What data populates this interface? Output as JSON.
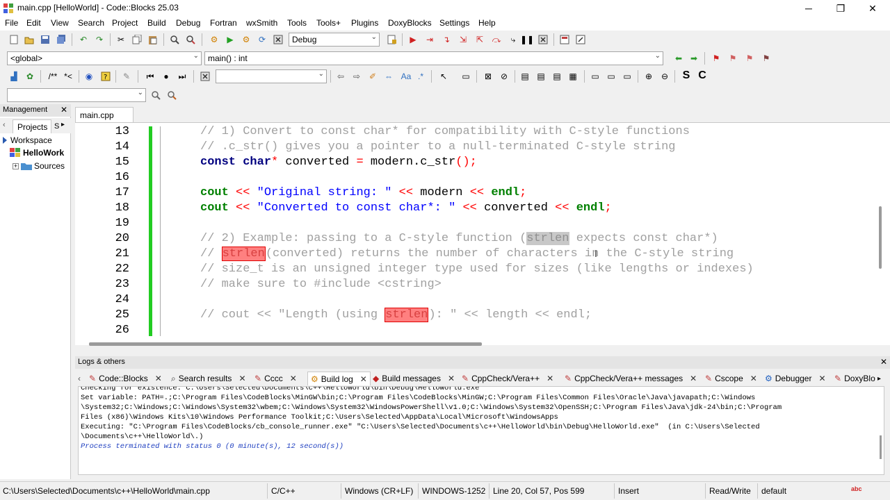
{
  "window": {
    "title": "main.cpp [HelloWorld] - Code::Blocks 25.03",
    "minimize": "─",
    "maximize": "❐",
    "close": "✕"
  },
  "menu": [
    "File",
    "Edit",
    "View",
    "Search",
    "Project",
    "Build",
    "Debug",
    "Fortran",
    "wxSmith",
    "Tools",
    "Tools+",
    "Plugins",
    "DoxyBlocks",
    "Settings",
    "Help"
  ],
  "toolbar": {
    "build_target": "Debug",
    "scope": "<global>",
    "function": "main() : int",
    "search_value": "",
    "find_value": ""
  },
  "management": {
    "title": "Management",
    "tab_projects": "Projects",
    "tab_symbols": "S",
    "workspace": "Workspace",
    "project": "HelloWork",
    "sources": "Sources"
  },
  "editor": {
    "tab_label": "main.cpp"
  },
  "code_lines": [
    {
      "n": "13",
      "text": "// 1) Convert to const char* for compatibility with C-style functions"
    },
    {
      "n": "14",
      "text": "// .c_str() gives you a pointer to a null-terminated C-style string"
    },
    {
      "n": "15",
      "p1": "const char",
      "p2": "*",
      "p3": " converted ",
      "p4": "=",
      "p5": " modern.c_str",
      "p6": "();"
    },
    {
      "n": "16"
    },
    {
      "n": "17",
      "p1": "cout",
      "p2": " << ",
      "p3": "\"Original string: \"",
      "p4": " << ",
      "p5": "modern",
      "p6": " << ",
      "p7": "endl",
      "p8": ";"
    },
    {
      "n": "18",
      "p1": "cout",
      "p2": " << ",
      "p3": "\"Converted to const char*: \"",
      "p4": " << ",
      "p5": "converted",
      "p6": " << ",
      "p7": "endl",
      "p8": ";"
    },
    {
      "n": "19"
    },
    {
      "n": "20",
      "p1": "// 2) Example: passing to a C-style function (",
      "p2": "strlen",
      "p3": " expects const char*)"
    },
    {
      "n": "21",
      "p1": "// ",
      "p2": "strlen",
      "p3": "(converted) returns the number of characters in the C-style string"
    },
    {
      "n": "22",
      "text": "// size_t is an unsigned integer type used for sizes (like lengths or indexes)"
    },
    {
      "n": "23",
      "text": "// make sure to #include <cstring>"
    },
    {
      "n": "24"
    },
    {
      "n": "25",
      "p1": "// cout << \"Length (using ",
      "p2": "strlen",
      "p3": "): \" << length << endl;"
    },
    {
      "n": "26"
    }
  ],
  "logs": {
    "title": "Logs & others",
    "tabs": [
      "Code::Blocks",
      "Search results",
      "Cccc",
      "Build log",
      "Build messages",
      "CppCheck/Vera++",
      "CppCheck/Vera++ messages",
      "Cscope",
      "Debugger",
      "DoxyBlo"
    ],
    "lines": [
      "Checking for existence: C:\\Users\\Selected\\Documents\\c++\\HelloWorld\\bin\\Debug\\HelloWorld.exe",
      "Set variable: PATH=.;C:\\Program Files\\CodeBlocks\\MinGW\\bin;C:\\Program Files\\CodeBlocks\\MinGW;C:\\Program Files\\Common Files\\Oracle\\Java\\javapath;C:\\Windows",
      "\\System32;C:\\Windows;C:\\Windows\\System32\\wbem;C:\\Windows\\System32\\WindowsPowerShell\\v1.0;C:\\Windows\\System32\\OpenSSH;C:\\Program Files\\Java\\jdk-24\\bin;C:\\Program",
      "Files (x86)\\Windows Kits\\10\\Windows Performance Toolkit;C:\\Users\\Selected\\AppData\\Local\\Microsoft\\WindowsApps",
      "Executing: \"C:\\Program Files\\CodeBlocks/cb_console_runner.exe\" \"C:\\Users\\Selected\\Documents\\c++\\HelloWorld\\bin\\Debug\\HelloWorld.exe\"  (in C:\\Users\\Selected",
      "\\Documents\\c++\\HelloWorld\\.)",
      "Process terminated with status 0 (0 minute(s), 12 second(s))"
    ]
  },
  "status": {
    "path": "C:\\Users\\Selected\\Documents\\c++\\HelloWorld\\main.cpp",
    "lang": "C/C++",
    "eol": "Windows (CR+LF)",
    "encoding": "WINDOWS-1252",
    "position": "Line 20, Col 57, Pos 599",
    "mode": "Insert",
    "access": "Read/Write",
    "profile": "default"
  }
}
